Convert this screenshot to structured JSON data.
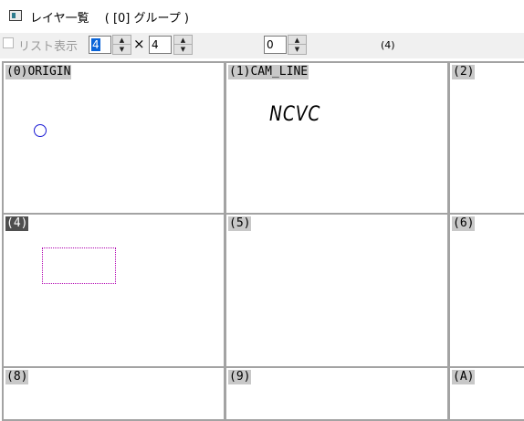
{
  "window": {
    "title": "レイヤ一覧　 ( [0] グループ )",
    "icon": "layer-window-icon"
  },
  "toolbar": {
    "list_view_label": "リスト表示",
    "list_view_checked": false,
    "columns_value": "4",
    "rows_value": "4",
    "times_symbol": "×",
    "group_value": "0",
    "count_display": "(4)",
    "spinner_up": "▲",
    "spinner_down": "▼"
  },
  "layers": [
    {
      "label": "(0)ORIGIN",
      "content": "circle",
      "selected": false
    },
    {
      "label": "(1)CAM_LINE",
      "content": "NCVC",
      "selected": false
    },
    {
      "label": "(2)",
      "content": "",
      "selected": false
    },
    {
      "label": "(4)",
      "content": "dotted-rectangle",
      "selected": true
    },
    {
      "label": "(5)",
      "content": "",
      "selected": false
    },
    {
      "label": "(6)",
      "content": "",
      "selected": false
    },
    {
      "label": "(8)",
      "content": "",
      "selected": false
    },
    {
      "label": "(9)",
      "content": "",
      "selected": false
    },
    {
      "label": "(A)",
      "content": "",
      "selected": false
    }
  ],
  "colors": {
    "selected_label_bg": "#4f4f4f",
    "label_bg": "#c8c8c8",
    "circle_stroke": "#1a1ad4",
    "rect_stroke": "#b000b0",
    "input_selection": "#0a64d8"
  }
}
